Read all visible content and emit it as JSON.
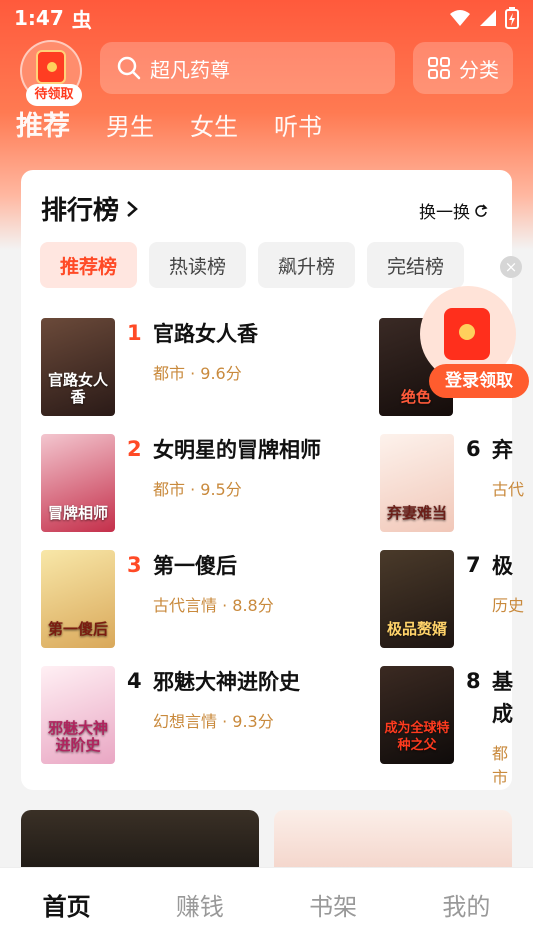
{
  "status": {
    "time": "1:47",
    "bug": "虫"
  },
  "reward_badge": {
    "label": "待领取"
  },
  "search": {
    "placeholder": "超凡药尊"
  },
  "category": {
    "label": "分类"
  },
  "top_tabs": [
    "推荐",
    "男生",
    "女生",
    "听书"
  ],
  "ranking": {
    "title": "排行榜",
    "refresh": "换一换",
    "sub_tabs": [
      "推荐榜",
      "热读榜",
      "飙升榜",
      "完结榜"
    ],
    "books": [
      {
        "rank": "1",
        "title": "官路女人香",
        "meta": "都市 · 9.6分",
        "cover_text": "官路女人香"
      },
      {
        "rank": "2",
        "title": "女明星的冒牌相师",
        "meta": "都市 · 9.5分",
        "cover_text": "冒牌相师"
      },
      {
        "rank": "3",
        "title": "第一傻后",
        "meta": "古代言情 · 8.8分",
        "cover_text": "第一傻后"
      },
      {
        "rank": "4",
        "title": "邪魅大神进阶史",
        "meta": "幻想言情 · 9.3分",
        "cover_text": "邪魅大神进阶史"
      },
      {
        "rank": "6",
        "title": "弃",
        "meta": "古代",
        "cover_text": "弃妻难当"
      },
      {
        "rank": "7",
        "title": "极",
        "meta": "历史",
        "cover_text": "极品赘婿"
      },
      {
        "rank": "8",
        "title": "基成",
        "meta": "都市",
        "cover_text": "成为全球特种之父"
      }
    ],
    "book5_cover_text": "绝色"
  },
  "login_reward": {
    "label": "登录领取"
  },
  "bottom_nav": [
    "首页",
    "赚钱",
    "书架",
    "我的"
  ],
  "colors": {
    "accent": "#ff4a26",
    "meta": "#c98a3d"
  }
}
